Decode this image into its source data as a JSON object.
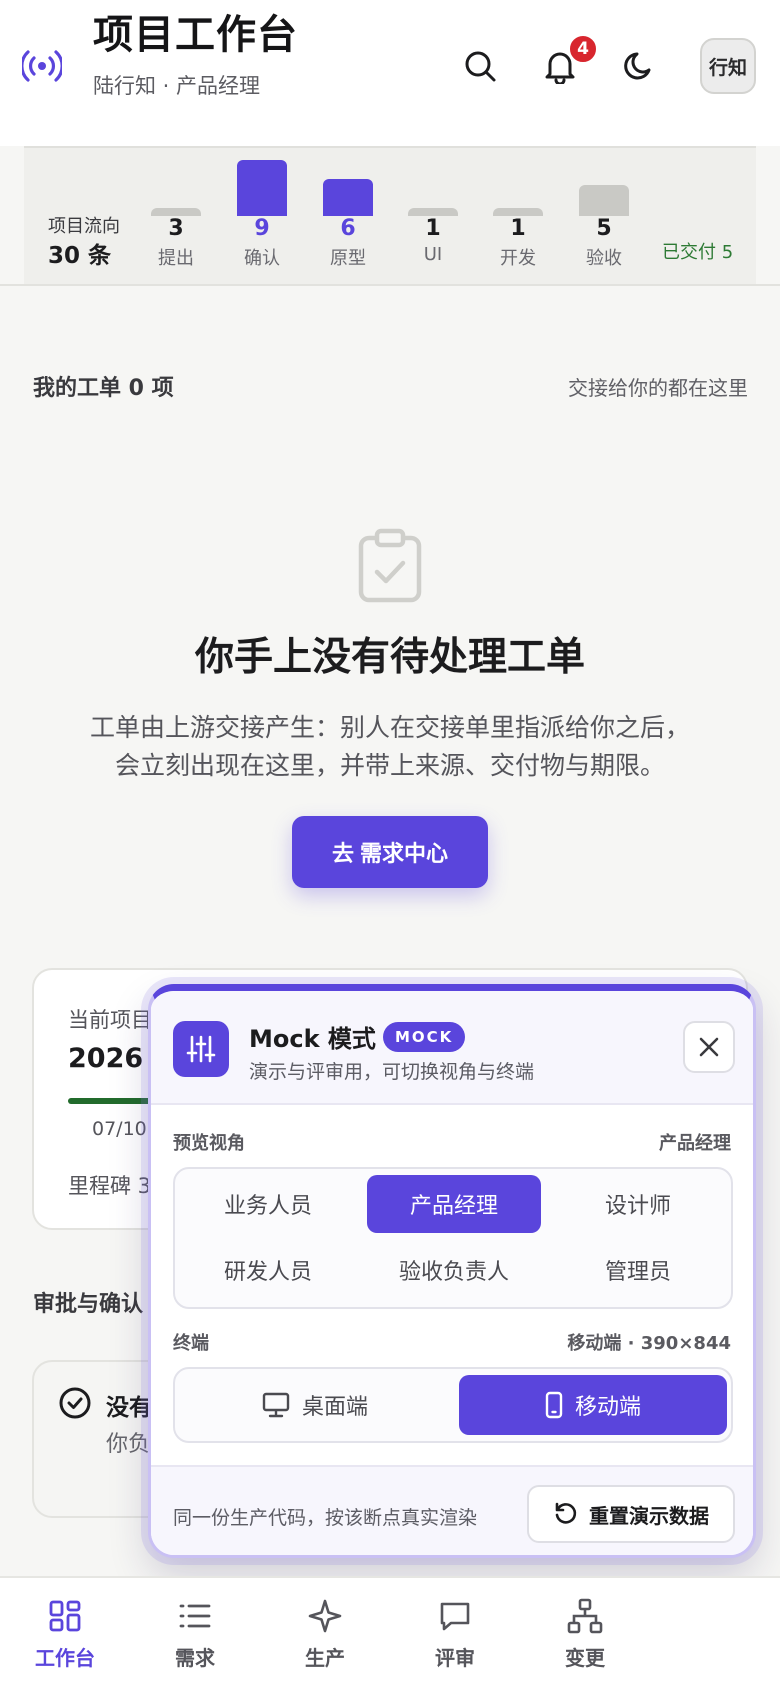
{
  "header": {
    "title": "项目工作台",
    "subtitle": "陆行知 · 产品经理",
    "notification_count": "4",
    "avatar_text": "行知"
  },
  "flow": {
    "label": "项目流向",
    "total": "30 条",
    "stages": [
      {
        "count": "3",
        "name": "提出",
        "value": 3,
        "color": "#c9c9c5",
        "count_color": "#1c1c1e"
      },
      {
        "count": "9",
        "name": "确认",
        "value": 9,
        "color": "#5a45dc",
        "count_color": "#5a45dc"
      },
      {
        "count": "6",
        "name": "原型",
        "value": 6,
        "color": "#5a45dc",
        "count_color": "#5a45dc"
      },
      {
        "count": "1",
        "name": "UI",
        "value": 1,
        "color": "#c9c9c5",
        "count_color": "#1c1c1e"
      },
      {
        "count": "1",
        "name": "开发",
        "value": 1,
        "color": "#c9c9c5",
        "count_color": "#1c1c1e"
      },
      {
        "count": "5",
        "name": "验收",
        "value": 5,
        "color": "#c9c9c5",
        "count_color": "#1c1c1e"
      }
    ],
    "delivered": "已交付 5"
  },
  "work_orders": {
    "title": "我的工单 0 项",
    "hint": "交接给你的都在这里",
    "empty_title": "你手上没有待处理工单",
    "empty_desc_line1": "工单由上游交接产生：别人在交接单里指派给你之后，",
    "empty_desc_line2": "会立刻出现在这里，并带上来源、交付物与期限。",
    "cta": "去 需求中心"
  },
  "project_card": {
    "label": "当前项目",
    "name": "2026 下",
    "start_date": "07/10",
    "milestone": "里程碑 3",
    "progress": 0.22
  },
  "approval": {
    "title": "审批与确认",
    "card_title": "没有",
    "card_desc": "你负"
  },
  "mock_panel": {
    "title": "Mock 模式",
    "badge": "MOCK",
    "subtitle": "演示与评审用，可切换视角与终端",
    "role_label": "预览视角",
    "role_value": "产品经理",
    "roles": [
      "业务人员",
      "产品经理",
      "设计师",
      "研发人员",
      "验收负责人",
      "管理员"
    ],
    "active_role": 1,
    "terminal_label": "终端",
    "terminal_value": "移动端 · 390×844",
    "terminals": [
      "桌面端",
      "移动端"
    ],
    "active_terminal": 1,
    "footer_text": "同一份生产代码，按该断点真实渲染",
    "reset_label": "重置演示数据"
  },
  "nav": {
    "items": [
      {
        "label": "工作台",
        "icon": "grid-icon"
      },
      {
        "label": "需求",
        "icon": "list-icon"
      },
      {
        "label": "生产",
        "icon": "sparkle-icon"
      },
      {
        "label": "评审",
        "icon": "chat-icon"
      },
      {
        "label": "变更",
        "icon": "hierarchy-icon"
      }
    ],
    "active": 0
  },
  "colors": {
    "accent": "#5a45dc",
    "badge_red": "#d8262e",
    "success_green": "#2d7a34"
  }
}
